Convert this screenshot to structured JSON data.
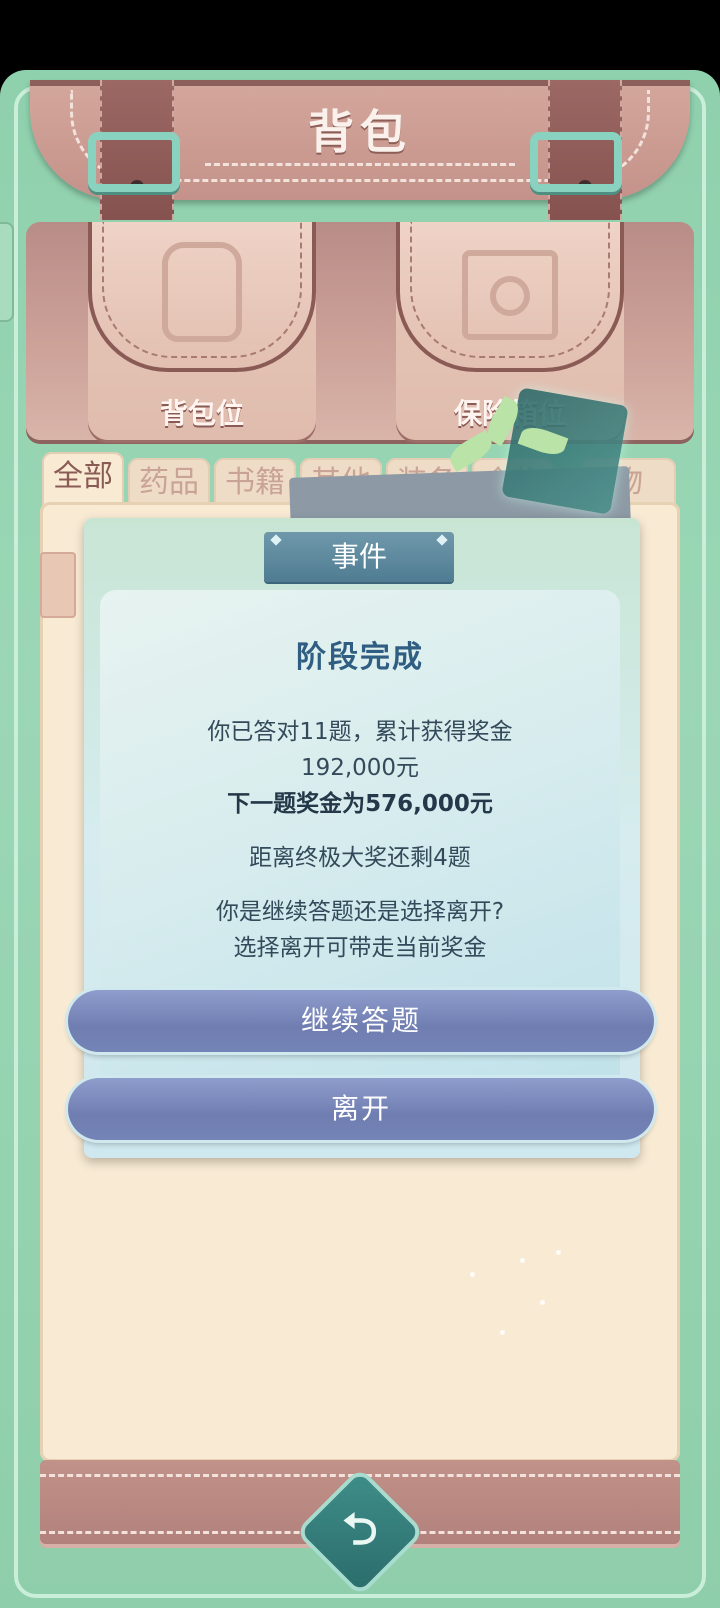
{
  "header": {
    "title": "背包"
  },
  "pockets": [
    {
      "label": "背包位",
      "icon": "backpack-icon"
    },
    {
      "label": "保险箱位",
      "icon": "safe-icon"
    }
  ],
  "tabs": [
    {
      "label": "全部",
      "active": true
    },
    {
      "label": "药品"
    },
    {
      "label": "书籍"
    },
    {
      "label": "其他"
    },
    {
      "label": "装备"
    },
    {
      "label": "食物"
    },
    {
      "label": "物"
    }
  ],
  "dialog": {
    "header": "事件",
    "title": "阶段完成",
    "line1": "你已答对11题，累计获得奖金",
    "line2": "192,000元",
    "line3": "下一题奖金为576,000元",
    "line4": "距离终极大奖还剩4题",
    "line5": "你是继续答题还是选择离开?",
    "line6": "选择离开可带走当前奖金",
    "continue_label": "继续答题",
    "leave_label": "离开"
  },
  "footer": {
    "back_icon": "return-icon",
    "back_glyph": "⮌"
  },
  "colors": {
    "frame": "#8fd0ad",
    "leather": "#c4928a",
    "panel": "#f8ead3",
    "dialog_title": "#2f5e82",
    "button": "#7584b7"
  }
}
